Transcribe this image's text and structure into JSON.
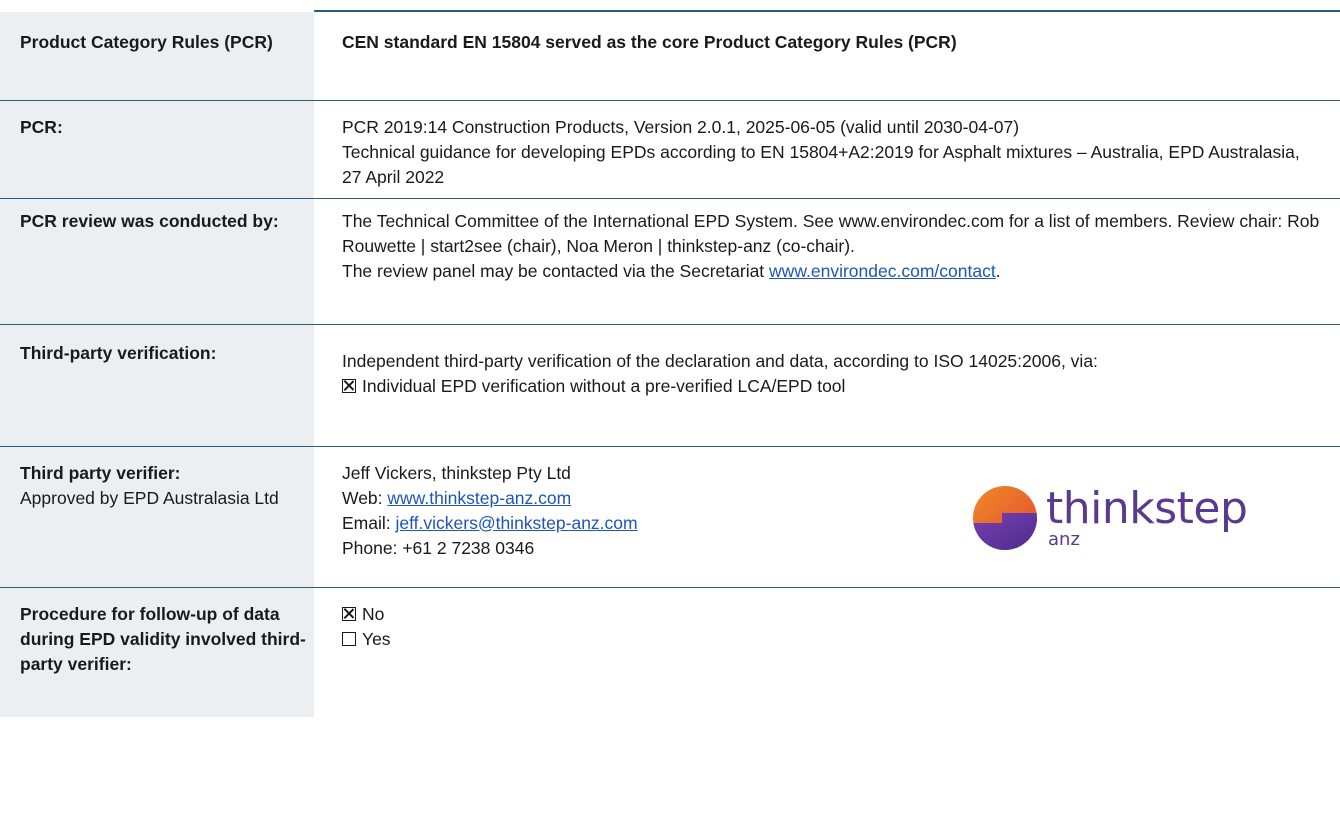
{
  "rows": {
    "pcr_header": {
      "label": "Product Category Rules (PCR)",
      "value": "CEN standard EN 15804 served as the core Product Category Rules (PCR)"
    },
    "pcr": {
      "label": "PCR:",
      "line1": "PCR 2019:14 Construction Products, Version 2.0.1, 2025-06-05 (valid until 2030-04-07)",
      "line2": "Technical guidance for developing EPDs according to EN 15804+A2:2019 for Asphalt mixtures – Australia, EPD Australasia, 27 April 2022"
    },
    "review": {
      "label": "PCR review was conducted by:",
      "text1": "The Technical Committee of the International EPD System. See www.environdec.com for a list of members. Review chair: Rob Rouwette | start2see (chair), Noa Meron | thinkstep-anz (co-chair).",
      "text2_prefix": "The review panel may be contacted via the Secretariat ",
      "link": "www.environdec.com/contact",
      "text2_suffix": "."
    },
    "third_party_verification": {
      "label": "Third-party verification:",
      "text": "Independent third-party verification of the declaration and data, according to ISO 14025:2006, via:",
      "option": "Individual EPD verification without a pre-verified LCA/EPD tool"
    },
    "verifier": {
      "label": "Third party verifier:",
      "sublabel": "Approved by EPD Australasia Ltd",
      "name": "Jeff Vickers, thinkstep Pty Ltd",
      "web_label": "Web: ",
      "web_link": "www.thinkstep-anz.com",
      "email_label": "Email: ",
      "email_link": "jeff.vickers@thinkstep-anz.com",
      "phone": "Phone: +61 2 7238 0346",
      "logo_text": "thinkstep",
      "logo_sub": "anz"
    },
    "followup": {
      "label": "Procedure for follow-up of data during EPD validity involved third-party verifier:",
      "option_no": "No",
      "option_yes": "Yes"
    }
  },
  "colors": {
    "label_bg": "#eceff2",
    "rule": "#2f5d7c",
    "link": "#1f55b8",
    "logo_orange": "#e8622a",
    "logo_purple": "#5a3a8e"
  }
}
